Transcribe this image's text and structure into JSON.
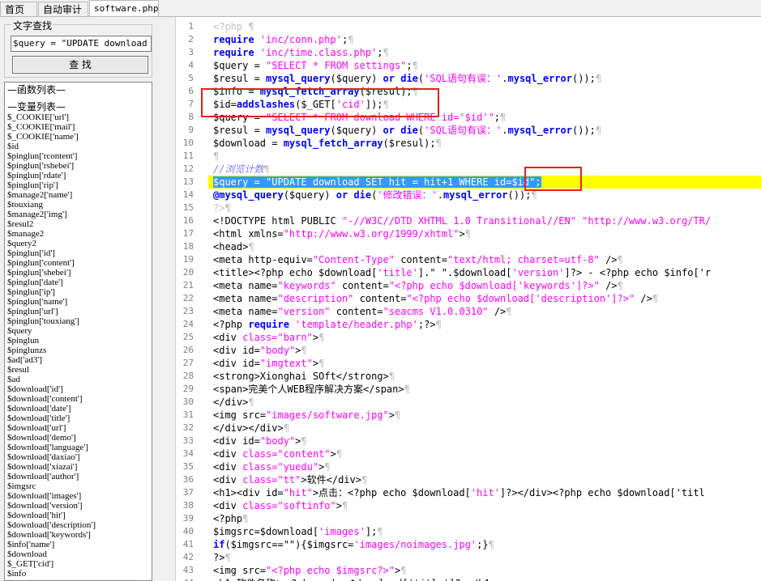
{
  "tabs": [
    {
      "label": "首页"
    },
    {
      "label": "自动审计"
    },
    {
      "label": "software.php"
    }
  ],
  "left": {
    "group_title": "文字查找",
    "search_value": "$query = \"UPDATE download SE",
    "find_button": "查 找",
    "functions_header": "—函数列表—",
    "variables_header": "—变量列表—",
    "variables": [
      "$_COOKIE['url']",
      "$_COOKIE['mail']",
      "$_COOKIE['name']",
      "$id",
      "$pinglun['rcontent']",
      "$pinglun['rshebei']",
      "$pinglun['rdate']",
      "$pinglun['rip']",
      "$manage2['name']",
      "$touxiang",
      "$manage2['img']",
      "$resul2",
      "$manage2",
      "$query2",
      "$pinglun['id']",
      "$pinglun['content']",
      "$pinglun['shebei']",
      "$pinglun['date']",
      "$pinglun['ip']",
      "$pinglun['name']",
      "$pinglun['url']",
      "$pinglun['touxiang']",
      "$query",
      "$pinglun",
      "$pinglunzs",
      "$ad['ad3']",
      "$resul",
      "$ad",
      "$download['id']",
      "$download['content']",
      "$download['date']",
      "$download['title']",
      "$download['url']",
      "$download['demo']",
      "$download['language']",
      "$download['daxiao']",
      "$download['xiazai']",
      "$download['author']",
      "$imgsrc",
      "$download['images']",
      "$download['version']",
      "$download['hit']",
      "$download['description']",
      "$download['keywords']",
      "$info['name']",
      "$download",
      "$_GET['cid']",
      "$info"
    ]
  },
  "editor": {
    "lines": [
      [
        [
          "p",
          "<?php ¶"
        ]
      ],
      [
        [
          "k",
          "require "
        ],
        [
          "s",
          "'inc/conn.php'"
        ],
        [
          "v",
          ";"
        ],
        [
          "p",
          "¶"
        ]
      ],
      [
        [
          "k",
          "require "
        ],
        [
          "s",
          "'inc/time.class.php'"
        ],
        [
          "v",
          ";"
        ],
        [
          "p",
          "¶"
        ]
      ],
      [
        [
          "v",
          "$query = "
        ],
        [
          "s",
          "\"SELECT * FROM settings\""
        ],
        [
          "v",
          ";"
        ],
        [
          "p",
          "¶"
        ]
      ],
      [
        [
          "v",
          "$resul = "
        ],
        [
          "k",
          "mysql_query"
        ],
        [
          "v",
          "($query) "
        ],
        [
          "k",
          "or die"
        ],
        [
          "v",
          "("
        ],
        [
          "s",
          "'SQL语句有误：'"
        ],
        [
          "v",
          "."
        ],
        [
          "k",
          "mysql_error"
        ],
        [
          "v",
          "());"
        ],
        [
          "p",
          "¶"
        ]
      ],
      [
        [
          "v",
          "$info = "
        ],
        [
          "k",
          "mysql_fetch_array"
        ],
        [
          "v",
          "($resul);"
        ],
        [
          "p",
          "¶"
        ]
      ],
      [
        [
          "v",
          "$id="
        ],
        [
          "k",
          "addslashes"
        ],
        [
          "v",
          "($_GET["
        ],
        [
          "s",
          "'cid'"
        ],
        [
          "v",
          "]);"
        ],
        [
          "p",
          "¶"
        ]
      ],
      [
        [
          "v",
          "$query = "
        ],
        [
          "s",
          "\"SELECT * FROM download WHERE id='$id'\""
        ],
        [
          "v",
          ";"
        ],
        [
          "p",
          "¶"
        ]
      ],
      [
        [
          "v",
          "$resul = "
        ],
        [
          "k",
          "mysql_query"
        ],
        [
          "v",
          "($query) "
        ],
        [
          "k",
          "or die"
        ],
        [
          "v",
          "("
        ],
        [
          "s",
          "'SQL语句有误：'"
        ],
        [
          "v",
          "."
        ],
        [
          "k",
          "mysql_error"
        ],
        [
          "v",
          "());"
        ],
        [
          "p",
          "¶"
        ]
      ],
      [
        [
          "v",
          "$download = "
        ],
        [
          "k",
          "mysql_fetch_array"
        ],
        [
          "v",
          "($resul);"
        ],
        [
          "p",
          "¶"
        ]
      ],
      [
        [
          "p",
          "¶"
        ]
      ],
      [
        [
          "c",
          "//浏览计数"
        ],
        [
          "p",
          "¶"
        ]
      ],
      [
        [
          "sel",
          "$query = \"UPDATE download SET hit = hit+1 WHERE id=$id\";"
        ]
      ],
      [
        [
          "k",
          "@mysql_query"
        ],
        [
          "v",
          "($query) "
        ],
        [
          "k",
          "or die"
        ],
        [
          "v",
          "("
        ],
        [
          "s",
          "'修改错误：'"
        ],
        [
          "v",
          "."
        ],
        [
          "k",
          "mysql_error"
        ],
        [
          "v",
          "());"
        ],
        [
          "p",
          "¶"
        ]
      ],
      [
        [
          "p",
          "?>¶"
        ]
      ],
      [
        [
          "v",
          "<!DOCTYPE html PUBLIC "
        ],
        [
          "s",
          "\"-//W3C//DTD XHTML 1.0 Transitional//EN\" \"http://www.w3.org/TR/"
        ]
      ],
      [
        [
          "v",
          "<html xmlns="
        ],
        [
          "s",
          "\"http://www.w3.org/1999/xhtml\""
        ],
        [
          "v",
          ">"
        ],
        [
          "p",
          "¶"
        ]
      ],
      [
        [
          "v",
          "<head>"
        ],
        [
          "p",
          "¶"
        ]
      ],
      [
        [
          "v",
          "<meta http-equiv="
        ],
        [
          "s",
          "\"Content-Type\""
        ],
        [
          "v",
          " content="
        ],
        [
          "s",
          "\"text/html; charset=utf-8\""
        ],
        [
          "v",
          " />"
        ],
        [
          "p",
          "¶"
        ]
      ],
      [
        [
          "v",
          "<title><?php echo $download["
        ],
        [
          "s",
          "'title'"
        ],
        [
          "v",
          "].\" \".$download["
        ],
        [
          "s",
          "'version'"
        ],
        [
          "v",
          "]?> - <?php echo $info['r"
        ]
      ],
      [
        [
          "v",
          "<meta name="
        ],
        [
          "s",
          "\"keywords\""
        ],
        [
          "v",
          " content="
        ],
        [
          "s",
          "\"<?php echo $download['keywords']?>\""
        ],
        [
          "v",
          " />"
        ],
        [
          "p",
          "¶"
        ]
      ],
      [
        [
          "v",
          "<meta name="
        ],
        [
          "s",
          "\"description\""
        ],
        [
          "v",
          " content="
        ],
        [
          "s",
          "\"<?php echo $download['description']?>\""
        ],
        [
          "v",
          " />"
        ],
        [
          "p",
          "¶"
        ]
      ],
      [
        [
          "v",
          "<meta name="
        ],
        [
          "s",
          "\"version\""
        ],
        [
          "v",
          " content="
        ],
        [
          "s",
          "\"seacms V1.0.0310\""
        ],
        [
          "v",
          " />"
        ],
        [
          "p",
          "¶"
        ]
      ],
      [
        [
          "v",
          "<?php "
        ],
        [
          "k",
          "require "
        ],
        [
          "s",
          "'template/header.php'"
        ],
        [
          "v",
          ";?>"
        ],
        [
          "p",
          "¶"
        ]
      ],
      [
        [
          "v",
          "<div "
        ],
        [
          "s",
          "class="
        ],
        [
          "s",
          "\"barn\""
        ],
        [
          "v",
          ">"
        ],
        [
          "p",
          "¶"
        ]
      ],
      [
        [
          "v",
          "<div id="
        ],
        [
          "s",
          "\"body\""
        ],
        [
          "v",
          ">"
        ],
        [
          "p",
          "¶"
        ]
      ],
      [
        [
          "v",
          "<div id="
        ],
        [
          "s",
          "\"imgtext\""
        ],
        [
          "v",
          ">"
        ],
        [
          "p",
          "¶"
        ]
      ],
      [
        [
          "v",
          "<strong>Xionghai SOft</strong>"
        ],
        [
          "p",
          "¶"
        ]
      ],
      [
        [
          "v",
          "<span>完美个人WEB程序解决方案</span>"
        ],
        [
          "p",
          "¶"
        ]
      ],
      [
        [
          "v",
          "</div>"
        ],
        [
          "p",
          "¶"
        ]
      ],
      [
        [
          "v",
          "<img src="
        ],
        [
          "s",
          "\"images/software.jpg\""
        ],
        [
          "v",
          ">"
        ],
        [
          "p",
          "¶"
        ]
      ],
      [
        [
          "v",
          "</div></div>"
        ],
        [
          "p",
          "¶"
        ]
      ],
      [
        [
          "v",
          "<div id="
        ],
        [
          "s",
          "\"body\""
        ],
        [
          "v",
          ">"
        ],
        [
          "p",
          "¶"
        ]
      ],
      [
        [
          "v",
          "<div "
        ],
        [
          "s",
          "class="
        ],
        [
          "s",
          "\"content\""
        ],
        [
          "v",
          ">"
        ],
        [
          "p",
          "¶"
        ]
      ],
      [
        [
          "v",
          "<div "
        ],
        [
          "s",
          "class="
        ],
        [
          "s",
          "\"yuedu\""
        ],
        [
          "v",
          ">"
        ],
        [
          "p",
          "¶"
        ]
      ],
      [
        [
          "v",
          "<div "
        ],
        [
          "s",
          "class="
        ],
        [
          "s",
          "\"tt\""
        ],
        [
          "v",
          ">软件</div>"
        ],
        [
          "p",
          "¶"
        ]
      ],
      [
        [
          "v",
          "<h1><div id="
        ],
        [
          "s",
          "\"hit\""
        ],
        [
          "v",
          ">点击：<?php echo $download["
        ],
        [
          "s",
          "'hit'"
        ],
        [
          "v",
          "]?></div><?php echo $download['titl"
        ]
      ],
      [
        [
          "v",
          "<div "
        ],
        [
          "s",
          "class="
        ],
        [
          "s",
          "\"softinfo\""
        ],
        [
          "v",
          ">"
        ],
        [
          "p",
          "¶"
        ]
      ],
      [
        [
          "v",
          "<?php"
        ],
        [
          "p",
          "¶"
        ]
      ],
      [
        [
          "v",
          "$imgsrc=$download["
        ],
        [
          "s",
          "'images'"
        ],
        [
          "v",
          "];"
        ],
        [
          "p",
          "¶"
        ]
      ],
      [
        [
          "k",
          "if"
        ],
        [
          "v",
          "($imgsrc==\"\"){$imgsrc="
        ],
        [
          "s",
          "'images/noimages.jpg'"
        ],
        [
          "v",
          ";}"
        ],
        [
          "p",
          "¶"
        ]
      ],
      [
        [
          "v",
          "?>"
        ],
        [
          "p",
          "¶"
        ]
      ],
      [
        [
          "v",
          "<img src="
        ],
        [
          "s",
          "\"<?php echo $imgsrc?>\""
        ],
        [
          "v",
          ">"
        ],
        [
          "p",
          "¶"
        ]
      ],
      [
        [
          "v",
          "<h1>软件名称：<?php echo $download['title']?></h1>"
        ]
      ]
    ],
    "highlight_line": 13
  },
  "colors": {
    "accent_highlight": "#ffff00",
    "selection": "#3399ff",
    "annotation_box": "#e41f1f",
    "keyword": "#0000ff",
    "string": "#ff00ff",
    "comment": "#8080ff"
  }
}
